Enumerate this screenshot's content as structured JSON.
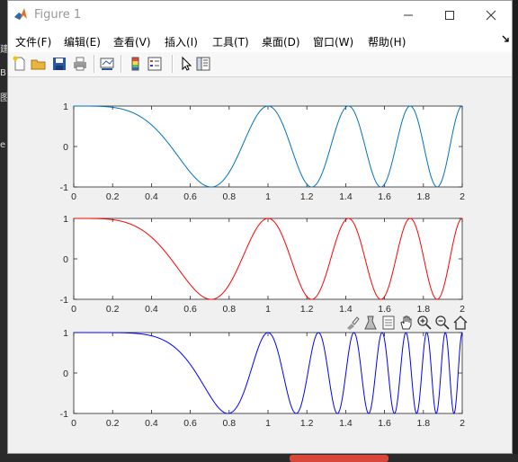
{
  "window": {
    "title": "Figure 1",
    "controls": {
      "minimize": "minimize",
      "maximize": "maximize",
      "close": "close"
    }
  },
  "menu": [
    "文件(F)",
    "编辑(E)",
    "查看(V)",
    "插入(I)",
    "工具(T)",
    "桌面(D)",
    "窗口(W)",
    "帮助(H)"
  ],
  "toolbar": [
    "new-figure-icon",
    "open-file-icon",
    "save-icon",
    "print-icon",
    "link-plot-icon",
    "colorbar-icon",
    "legend-icon",
    "edit-plot-arrow-icon",
    "property-inspector-icon"
  ],
  "axes_toolbar": [
    "brush-data-icon",
    "data-tips-icon",
    "pan-icon",
    "zoom-in-icon",
    "zoom-out-icon",
    "restore-view-icon"
  ],
  "background_glyphs": [
    "建",
    "B",
    "图",
    "e"
  ],
  "chart_data": [
    {
      "type": "line",
      "title": "",
      "xlabel": "",
      "ylabel": "",
      "xlim": [
        0,
        2
      ],
      "ylim": [
        -1,
        1
      ],
      "xticks": [
        "0",
        "0.2",
        "0.4",
        "0.6",
        "0.8",
        "1",
        "1.2",
        "1.4",
        "1.6",
        "1.8",
        "2"
      ],
      "yticks": [
        "1",
        "0",
        "-1"
      ],
      "grid": false,
      "series": [
        {
          "function": "y = cos(2π·x²)",
          "color": "#0072bd"
        }
      ]
    },
    {
      "type": "line",
      "title": "",
      "xlabel": "",
      "ylabel": "",
      "xlim": [
        0,
        2
      ],
      "ylim": [
        -1,
        1
      ],
      "xticks": [
        "0",
        "0.2",
        "0.4",
        "0.6",
        "0.8",
        "1",
        "1.2",
        "1.4",
        "1.6",
        "1.8",
        "2"
      ],
      "yticks": [
        "1",
        "0",
        "-1"
      ],
      "grid": false,
      "series": [
        {
          "function": "y = cos(2π·x²)",
          "color": "#ff0000"
        }
      ]
    },
    {
      "type": "line",
      "title": "",
      "xlabel": "",
      "ylabel": "",
      "xlim": [
        0,
        2
      ],
      "ylim": [
        -1,
        1
      ],
      "xticks": [
        "0",
        "0.2",
        "0.4",
        "0.6",
        "0.8",
        "1",
        "1.2",
        "1.4",
        "1.6",
        "1.8",
        "2"
      ],
      "yticks": [
        "1",
        "0",
        "-1"
      ],
      "grid": false,
      "series": [
        {
          "function": "y = cos(2π·x³)",
          "color": "#0000ff"
        }
      ]
    }
  ]
}
